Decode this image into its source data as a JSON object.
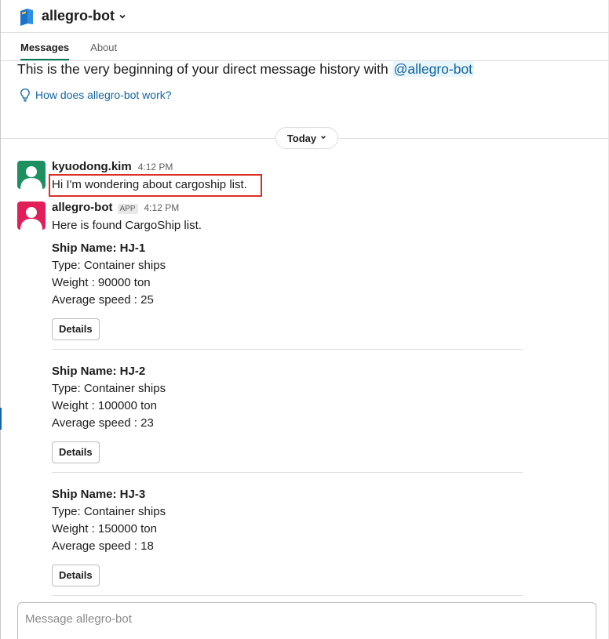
{
  "header": {
    "title": "allegro-bot",
    "icon": "bot-book-icon",
    "chevron": "⌄"
  },
  "tabs": [
    {
      "label": "Messages",
      "active": true
    },
    {
      "label": "About",
      "active": false
    }
  ],
  "intro": {
    "text": "This is the very beginning of your direct message history with ",
    "mention": "@allegro-bot",
    "help_link": "How does allegro-bot work?"
  },
  "divider": {
    "label": "Today"
  },
  "messages": [
    {
      "sender": "kyuodong.kim",
      "time": "4:12 PM",
      "text": "Hi I'm wondering about cargoship list.",
      "avatar_color": "#1e8f5e"
    },
    {
      "sender": "allegro-bot",
      "badge": "APP",
      "time": "4:12 PM",
      "text": "Here is found CargoShip list.",
      "avatar_color": "#e01e5a"
    }
  ],
  "ships": [
    {
      "name": "Ship Name: HJ-1",
      "type": "Type: Container ships",
      "weight": "Weight : 90000 ton",
      "speed": "Average speed : 25",
      "button": "Details"
    },
    {
      "name": "Ship Name: HJ-2",
      "type": "Type: Container ships",
      "weight": "Weight : 100000 ton",
      "speed": "Average speed : 23",
      "button": "Details"
    },
    {
      "name": "Ship Name: HJ-3",
      "type": "Type: Container ships",
      "weight": "Weight : 150000 ton",
      "speed": "Average speed : 18",
      "button": "Details"
    }
  ],
  "composer": {
    "placeholder": "Message allegro-bot"
  },
  "colors": {
    "accent": "#007a5a",
    "link": "#1264a3",
    "highlight": "#d93025"
  }
}
